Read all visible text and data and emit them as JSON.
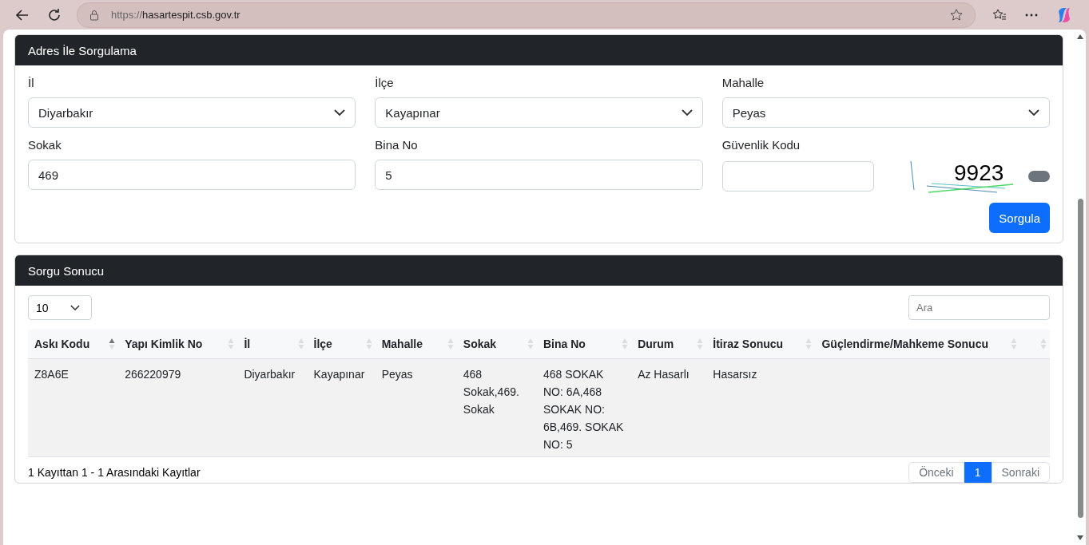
{
  "browser": {
    "url_prefix": "https://",
    "url_domain": "hasartespit.csb.gov.tr"
  },
  "search_card": {
    "title": "Adres İle Sorgulama",
    "selects": [
      {
        "label": "İl",
        "value": "Diyarbakır"
      },
      {
        "label": "İlçe",
        "value": "Kayapınar"
      },
      {
        "label": "Mahalle",
        "value": "Peyas"
      }
    ],
    "inputs": [
      {
        "label": "Sokak",
        "value": "469"
      },
      {
        "label": "Bina No",
        "value": "5"
      }
    ],
    "security": {
      "label": "Güvenlik Kodu",
      "captcha_text": "9923"
    },
    "submit": "Sorgula"
  },
  "result_card": {
    "title": "Sorgu Sonucu",
    "page_size": "10",
    "search_placeholder": "Ara",
    "columns": [
      {
        "label": "Askı Kodu",
        "sorted": true
      },
      {
        "label": "Yapı Kimlik No",
        "sorted": false
      },
      {
        "label": "İl",
        "sorted": false
      },
      {
        "label": "İlçe",
        "sorted": false
      },
      {
        "label": "Mahalle",
        "sorted": false
      },
      {
        "label": "Sokak",
        "sorted": false
      },
      {
        "label": "Bina No",
        "sorted": false
      },
      {
        "label": "Durum",
        "sorted": false
      },
      {
        "label": "İtiraz Sonucu",
        "sorted": false
      },
      {
        "label": "Güçlendirme/Mahkeme Sonucu",
        "sorted": false
      },
      {
        "sorted": false
      }
    ],
    "rows": [
      [
        "Z8A6E",
        "266220979",
        "Diyarbakır",
        "Kayapınar",
        "Peyas",
        "468 Sokak,469. Sokak",
        "468 SOKAK NO: 6A,468 SOKAK NO: 6B,469. SOKAK NO: 5",
        "Az Hasarlı",
        "Hasarsız",
        "",
        ""
      ]
    ],
    "info": "1 Kayıttan 1 - 1 Arasındaki Kayıtlar",
    "pagination": [
      {
        "label": "Önceki",
        "selected": false
      },
      {
        "label": "1",
        "selected": true
      },
      {
        "label": "Sonraki",
        "selected": false
      }
    ]
  }
}
